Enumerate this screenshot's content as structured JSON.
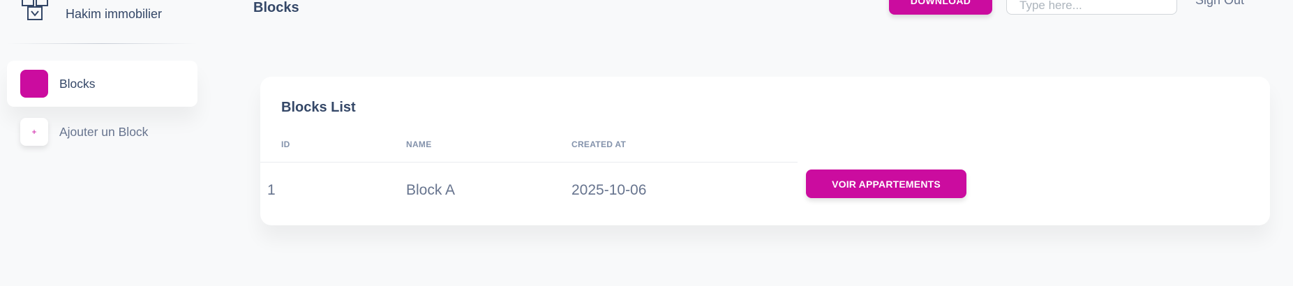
{
  "brand": {
    "name": "Hakim immobilier",
    "logo_icon": "building-icon"
  },
  "sidebar": {
    "items": [
      {
        "label": "Blocks",
        "icon": "square-icon",
        "active": true
      },
      {
        "label": "Ajouter un Block",
        "icon": "plus-icon",
        "icon_glyph": "+",
        "active": false
      }
    ]
  },
  "header": {
    "title": "Blocks",
    "download_label": "DOWNLOAD",
    "search_placeholder": "Type here...",
    "signout_label": "Sign Out"
  },
  "card": {
    "title": "Blocks List",
    "columns": [
      "ID",
      "NAME",
      "CREATED AT"
    ],
    "rows": [
      {
        "id": "1",
        "name": "Block A",
        "created_at": "2025-10-06",
        "action_label": "VOIR APPARTEMENTS"
      }
    ]
  },
  "colors": {
    "accent": "#cb0c9f",
    "text": "#344767",
    "muted": "#67748e",
    "background": "#f8f9fa"
  }
}
